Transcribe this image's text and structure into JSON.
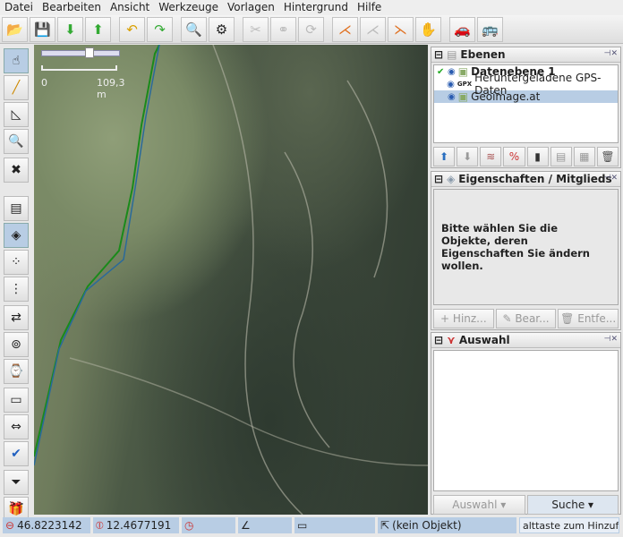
{
  "menu": [
    "Datei",
    "Bearbeiten",
    "Ansicht",
    "Werkzeuge",
    "Vorlagen",
    "Hintergrund",
    "Hilfe"
  ],
  "toolbar": [
    {
      "icon": "open-folder-icon"
    },
    {
      "icon": "save-icon"
    },
    {
      "icon": "download-icon"
    },
    {
      "icon": "upload-icon"
    },
    {
      "sep": true
    },
    {
      "icon": "undo-icon"
    },
    {
      "icon": "redo-icon"
    },
    {
      "sep": true
    },
    {
      "icon": "zoom-preview-icon"
    },
    {
      "icon": "preferences-icon"
    },
    {
      "sep": true
    },
    {
      "icon": "split-way-icon",
      "disabled": true
    },
    {
      "icon": "combine-way-icon",
      "disabled": true
    },
    {
      "icon": "reverse-icon",
      "disabled": true
    },
    {
      "sep": true
    },
    {
      "icon": "highway-icon"
    },
    {
      "icon": "path-icon",
      "disabled": true
    },
    {
      "icon": "junction-icon"
    },
    {
      "icon": "hand-icon"
    },
    {
      "sep": true
    },
    {
      "icon": "car-icon"
    },
    {
      "icon": "bus-icon"
    }
  ],
  "left_tools": [
    "select-icon",
    "draw-icon",
    "measure-icon",
    "zoom-icon",
    "delete-icon",
    "layers-icon",
    "tag-icon",
    "relation-icon",
    "selection-list-icon",
    "conflict-icon",
    "filter-icon",
    "history-icon",
    "author-icon",
    "validator-icon",
    "check-icon",
    "funnel-icon",
    "presets-icon"
  ],
  "left_more": ">>",
  "map": {
    "scale_label": "109,3 m",
    "scale_zero": "0"
  },
  "layers": {
    "title": "Ebenen",
    "items": [
      {
        "name": "Datenebene 1",
        "bold": true,
        "active": true
      },
      {
        "name": "Heruntergeladene GPS-Daten",
        "badge": "GPX"
      },
      {
        "name": "Geoimage.at",
        "selected": true
      }
    ]
  },
  "properties": {
    "title": "Eigenschaften / Mitglieds",
    "message": "Bitte wählen Sie die Objekte, deren Eigenschaften Sie ändern wollen.",
    "buttons": [
      "Hinz...",
      "Bear...",
      "Entfe..."
    ]
  },
  "selection": {
    "title": "Auswahl",
    "buttons": [
      "Auswahl",
      "Suche"
    ]
  },
  "status": {
    "lat": "46.8223142",
    "lon": "12.4677191",
    "object": "(kein Objekt)",
    "hint": "alttaste zum Hinzufü"
  }
}
